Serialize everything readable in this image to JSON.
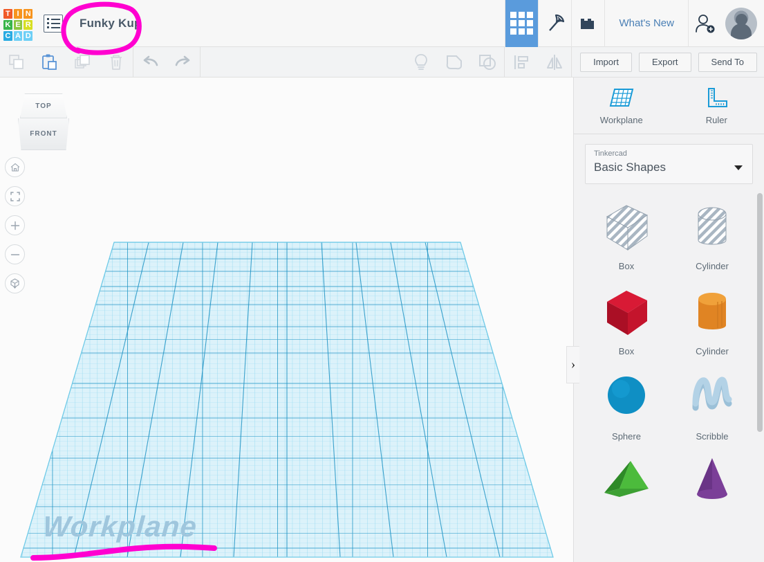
{
  "app": {
    "name": "Tinkercad",
    "logo_letters": [
      "T",
      "I",
      "N",
      "K",
      "E",
      "R",
      "C",
      "A",
      "D"
    ],
    "logo_colors": [
      "#f05a28",
      "#f7941e",
      "#f7941e",
      "#39b54a",
      "#8cc63f",
      "#d7df23",
      "#29abe2",
      "#6dcff6",
      "#6dcff6"
    ]
  },
  "topbar": {
    "menu_icon": "list-menu-icon",
    "project_title": "Funky Kup",
    "buttons": [
      {
        "name": "grid-view-button",
        "icon": "grid-icon",
        "active": true
      },
      {
        "name": "codeblocks-button",
        "icon": "pickaxe-icon",
        "active": false
      },
      {
        "name": "blocks-button",
        "icon": "brick-icon",
        "active": false
      }
    ],
    "whats_new_label": "What's New",
    "invite_icon": "add-person-icon",
    "avatar": "user-avatar"
  },
  "toolbar": {
    "left_tools": [
      {
        "name": "copy-button",
        "icon": "copy-icon",
        "enabled": false
      },
      {
        "name": "paste-button",
        "icon": "paste-icon",
        "enabled": true
      },
      {
        "name": "duplicate-button",
        "icon": "duplicate-icon",
        "enabled": false
      },
      {
        "name": "delete-button",
        "icon": "trash-icon",
        "enabled": false
      }
    ],
    "history_tools": [
      {
        "name": "undo-button",
        "icon": "undo-arrow-icon"
      },
      {
        "name": "redo-button",
        "icon": "redo-arrow-icon"
      }
    ],
    "edit_tools": [
      {
        "name": "hint-button",
        "icon": "lightbulb-icon"
      },
      {
        "name": "group-button",
        "icon": "group-shapes-icon"
      },
      {
        "name": "ungroup-button",
        "icon": "ungroup-shapes-icon"
      },
      {
        "name": "align-button",
        "icon": "align-icon"
      },
      {
        "name": "mirror-button",
        "icon": "mirror-flip-icon"
      }
    ],
    "import_label": "Import",
    "export_label": "Export",
    "send_to_label": "Send To"
  },
  "canvas": {
    "view_cube": {
      "top_face": "TOP",
      "front_face": "FRONT"
    },
    "nav_buttons": [
      {
        "name": "home-view-button",
        "icon": "home-icon"
      },
      {
        "name": "fit-to-view-button",
        "icon": "fit-frame-icon"
      },
      {
        "name": "zoom-in-button",
        "icon": "plus-icon"
      },
      {
        "name": "zoom-out-button",
        "icon": "minus-icon"
      },
      {
        "name": "projection-toggle-button",
        "icon": "cube-projection-icon"
      }
    ],
    "workplane_label": "Workplane",
    "grid_color": "#29abe2",
    "grid_fill": "#d6f0f9"
  },
  "right_panel": {
    "tools": [
      {
        "name": "workplane-tool",
        "label": "Workplane",
        "icon": "workplane-grid-icon"
      },
      {
        "name": "ruler-tool",
        "label": "Ruler",
        "icon": "ruler-icon"
      }
    ],
    "dropdown": {
      "category": "Tinkercad",
      "selection": "Basic Shapes",
      "caret": "chevron-down-icon"
    },
    "collapse_handle": "›",
    "shapes": [
      {
        "label": "Box",
        "kind": "box-hole",
        "color": "#b8c2cc"
      },
      {
        "label": "Cylinder",
        "kind": "cylinder-hole",
        "color": "#b8c2cc"
      },
      {
        "label": "Box",
        "kind": "box-solid",
        "color": "#c8102e"
      },
      {
        "label": "Cylinder",
        "kind": "cylinder-solid",
        "color": "#e8881e"
      },
      {
        "label": "Sphere",
        "kind": "sphere",
        "color": "#0f8fc4"
      },
      {
        "label": "Scribble",
        "kind": "scribble",
        "color": "#9bc0d8"
      },
      {
        "label": "",
        "kind": "pyramid",
        "color": "#3ea832"
      },
      {
        "label": "",
        "kind": "cone",
        "color": "#7b3f98"
      }
    ]
  },
  "annotations": {
    "color": "#ff00d0",
    "items": [
      {
        "name": "title-circle-annotation",
        "shape": "ellipse"
      },
      {
        "name": "workplane-underline-annotation",
        "shape": "stroke"
      }
    ]
  }
}
